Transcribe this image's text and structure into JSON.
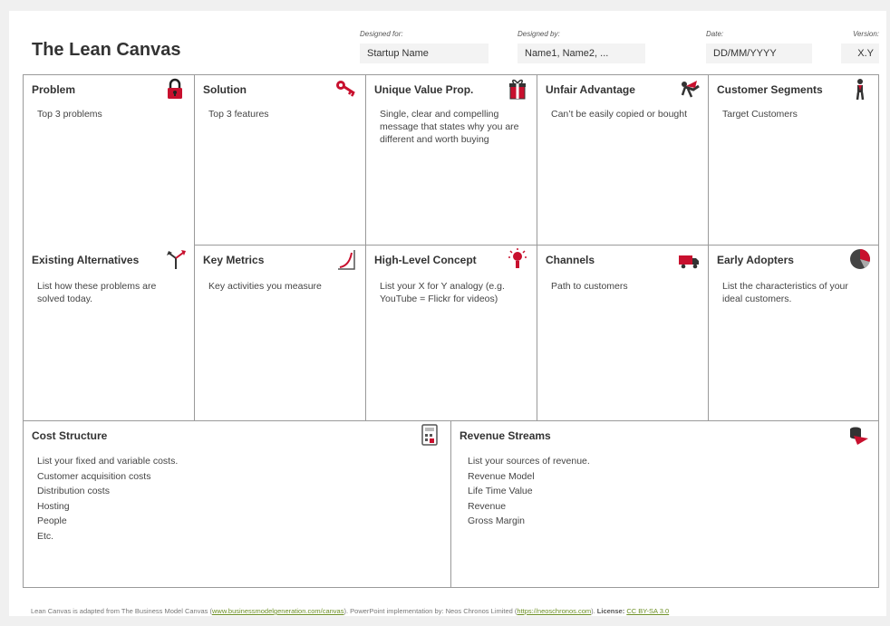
{
  "header": {
    "title": "The Lean Canvas",
    "designed_for_label": "Designed for:",
    "designed_for_value": "Startup Name",
    "designed_by_label": "Designed by:",
    "designed_by_value": "Name1, Name2, ...",
    "date_label": "Date:",
    "date_value": "DD/MM/YYYY",
    "version_label": "Version:",
    "version_value": "X.Y"
  },
  "blocks": {
    "problem": {
      "title": "Problem",
      "body": "Top 3 problems",
      "icon": "lock-icon"
    },
    "solution": {
      "title": "Solution",
      "body": "Top 3 features",
      "icon": "key-icon"
    },
    "uvp": {
      "title": "Unique Value Prop.",
      "body": "Single, clear and compelling message that states why you are different and worth buying",
      "icon": "gift-icon"
    },
    "unfair_advantage": {
      "title": "Unfair Advantage",
      "body": "Can’t be easily copied or bought",
      "icon": "superhero-icon"
    },
    "customer_segments": {
      "title": "Customer Segments",
      "body": "Target Customers",
      "icon": "person-icon"
    },
    "existing_alternatives": {
      "title": "Existing Alternatives",
      "body": "List how these problems are solved today.",
      "icon": "arrows-icon"
    },
    "key_metrics": {
      "title": "Key Metrics",
      "body": "Key activities you measure",
      "icon": "chart-icon"
    },
    "high_level_concept": {
      "title": "High-Level Concept",
      "body": "List your X for Y analogy (e.g. YouTube = Flickr for videos)",
      "icon": "lightbulb-icon"
    },
    "channels": {
      "title": "Channels",
      "body": "Path to customers",
      "icon": "truck-icon"
    },
    "early_adopters": {
      "title": "Early Adopters",
      "body": "List the characteristics of your ideal customers.",
      "icon": "pie-icon"
    },
    "cost_structure": {
      "title": "Cost Structure",
      "items": [
        "List your fixed and variable costs.",
        "Customer acquisition costs",
        "Distribution costs",
        "Hosting",
        "People",
        "Etc."
      ],
      "icon": "calculator-icon"
    },
    "revenue_streams": {
      "title": "Revenue Streams",
      "items": [
        "List your sources of revenue.",
        "Revenue Model",
        "Life Time Value",
        "Revenue",
        "Gross Margin"
      ],
      "icon": "money-icon"
    }
  },
  "footer": {
    "text1": "Lean Canvas is adapted from The Business Model Canvas (",
    "link1": "www.businessmodelgeneration.com/canvas",
    "text2": "). PowerPoint implementation by: Neos Chronos Limited (",
    "link2": "https://neoschronos.com",
    "text3": "). ",
    "license_label": "License:",
    "license_link": "CC BY-SA 3.0"
  },
  "colors": {
    "accent": "#c8102e",
    "border": "#9a9a9a",
    "field_bg": "#f3f3f3"
  }
}
